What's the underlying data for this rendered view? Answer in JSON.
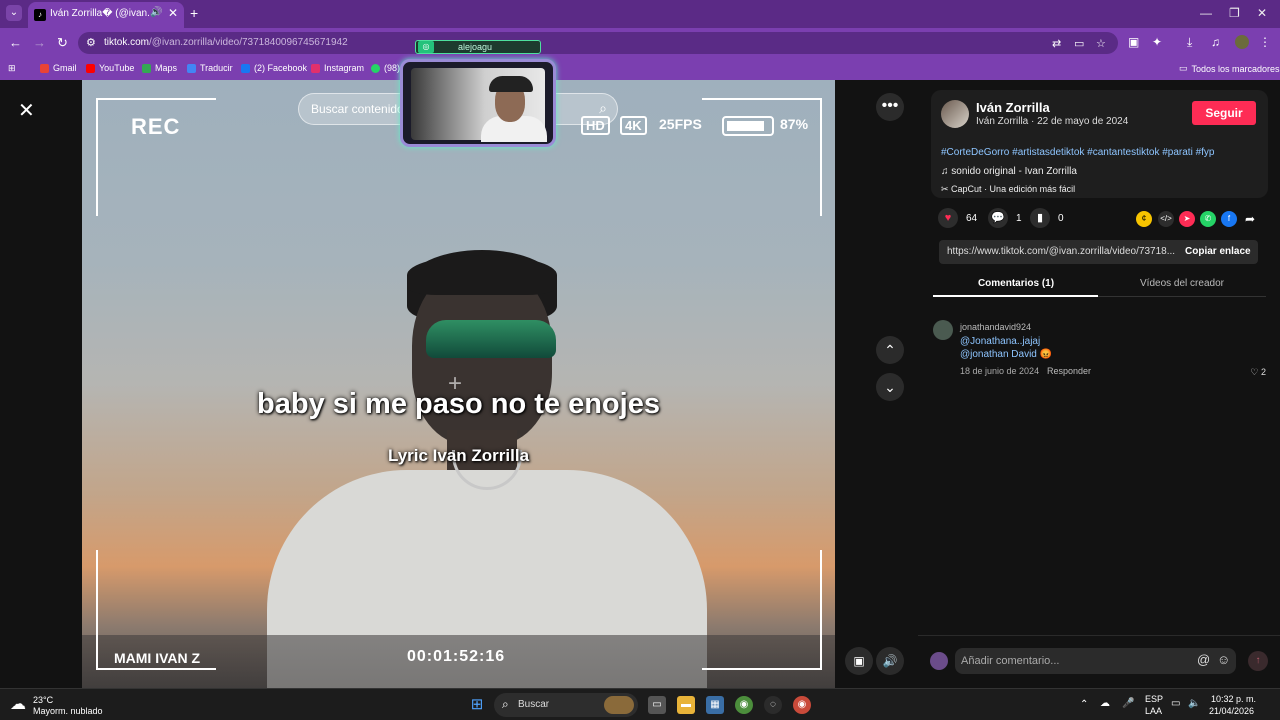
{
  "browser": {
    "tab_title": "Iván Zorrilla� (@ivan.zorrill",
    "url_host": "tiktok.com",
    "url_path": "/@ivan.zorrilla/video/7371840096745671942",
    "bookmarks": [
      {
        "label": "Gmail",
        "color": "#ea4335"
      },
      {
        "label": "YouTube",
        "color": "#ff0000"
      },
      {
        "label": "Maps",
        "color": "#34a853"
      },
      {
        "label": "Traducir",
        "color": "#4285f4"
      },
      {
        "label": "(2) Facebook",
        "color": "#1877f2"
      },
      {
        "label": "Instagram",
        "color": "#e1306c"
      },
      {
        "label": "(98)",
        "color": "#25d366"
      }
    ],
    "all_bookmarks": "Todos los marcadores"
  },
  "video": {
    "rec": "REC",
    "hd": "HD",
    "k4": "4K",
    "fps": "25FPS",
    "battery_pct": "87%",
    "battery_level": 0.87,
    "search_placeholder": "Buscar contenido",
    "lyric_main": "baby si me paso no te enojes",
    "lyric_credit": "Lyric Ivan Zorrilla",
    "corner_label": "MAMI IVAN Z",
    "timecode": "00:01:52:16"
  },
  "webcam": {
    "name": "alejoagu"
  },
  "panel": {
    "author_name": "Iván Zorrilla",
    "author_sub": "Iván Zorrilla⁣ · 22 de mayo de 2024",
    "follow_label": "Seguir",
    "hashtags": "#CorteDeGorro #artistasdetiktok #cantantestiktok #parati #fyp",
    "sound": "sonido original - Ivan Zorrilla",
    "capcut": "CapCut · Una edición más fácil",
    "likes": "64",
    "comments_count": "1",
    "saves": "0",
    "link": "https://www.tiktok.com/@ivan.zorrilla/video/73718...",
    "copy_label": "Copiar enlace",
    "tab_comments": "Comentarios (1)",
    "tab_creator": "Vídeos del creador",
    "comment": {
      "user": "jonathandavid924",
      "line1": "@Jonathana..jajaj",
      "line2": "@jonathan David",
      "date": "18 de junio de 2024",
      "reply": "Responder",
      "likes": "2"
    },
    "composer_placeholder": "Añadir comentario..."
  },
  "taskbar": {
    "temp": "23°C",
    "weather": "Mayorm. nublado",
    "search": "Buscar",
    "lang1": "ESP",
    "lang2": "LAA",
    "time": "10:32 p. m.",
    "date": "21/04/2026"
  }
}
